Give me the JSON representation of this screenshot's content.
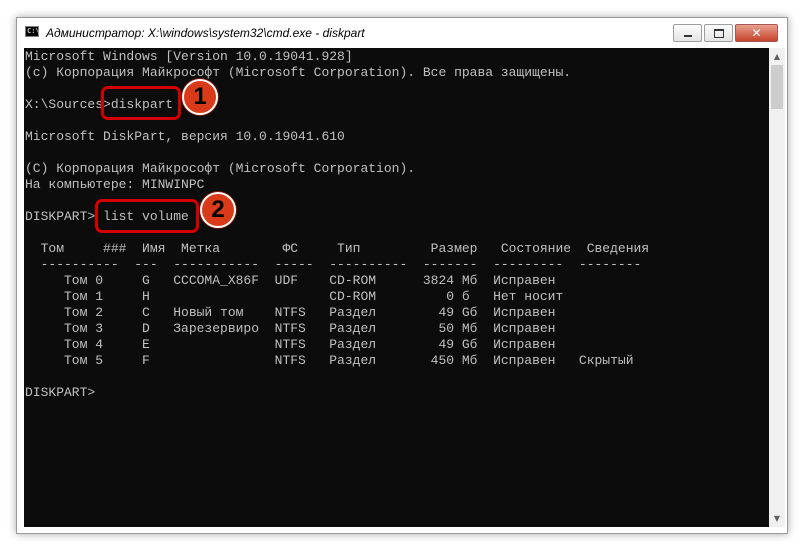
{
  "window": {
    "title": "Администратор: X:\\windows\\system32\\cmd.exe - diskpart",
    "icon_text": "C:\\"
  },
  "controls": {
    "close_glyph": "✕"
  },
  "console": {
    "lines": [
      "Microsoft Windows [Version 10.0.19041.928]",
      "(c) Корпорация Майкрософт (Microsoft Corporation). Все права защищены.",
      "",
      "X:\\Sources>diskpart",
      "",
      "Microsoft DiskPart, версия 10.0.19041.610",
      "",
      "(C) Корпорация Майкрософт (Microsoft Corporation).",
      "На компьютере: MINWINPC",
      "",
      "DISKPART> list volume",
      "",
      "  Том     ###  Имя  Метка        ФС     Тип         Размер   Состояние  Сведения",
      "  ----------  ---  -----------  -----  ----------  -------  ---------  --------",
      "     Том 0     G   CCCOMA_X86F  UDF    CD-ROM      3824 Mб  Исправен",
      "     Том 1     H                       CD-ROM         0 б   Нет носит",
      "     Том 2     C   Новый том    NTFS   Раздел        49 Gб  Исправен",
      "     Том 3     D   Зарезервиро  NTFS   Раздел        50 Mб  Исправен",
      "     Том 4     E                NTFS   Раздел        49 Gб  Исправен",
      "     Том 5     F                NTFS   Раздел       450 Mб  Исправен   Скрытый",
      "",
      "DISKPART>"
    ]
  },
  "annotations": {
    "badge_1": "1",
    "badge_2": "2",
    "highlight_color": "#d40000",
    "badge_color": "#d83a1a"
  }
}
